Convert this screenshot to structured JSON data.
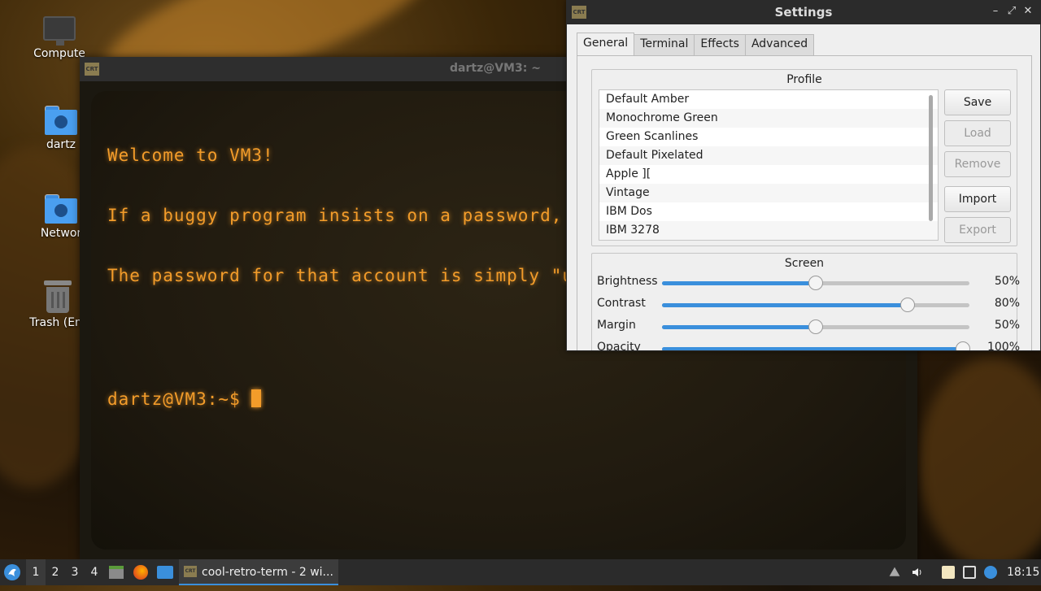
{
  "desktop": {
    "icons": [
      {
        "label": "Compute",
        "icon": "computer-icon"
      },
      {
        "label": "dartz",
        "icon": "home-folder-icon"
      },
      {
        "label": "Networ",
        "icon": "network-folder-icon"
      },
      {
        "label": "Trash (Em",
        "icon": "trash-icon"
      }
    ]
  },
  "terminal": {
    "app_icon": "CRT",
    "title": "dartz@VM3: ~",
    "lines": [
      "Welcome to VM3!",
      "If a buggy program insists on a password, us",
      "The password for that account is simply \"us"
    ],
    "prompt": "dartz@VM3:~$ ",
    "text_color": "#f39c2a"
  },
  "settings": {
    "app_icon": "CRT",
    "title": "Settings",
    "window_buttons": [
      "–",
      "⤢",
      "✕"
    ],
    "tabs": [
      "General",
      "Terminal",
      "Effects",
      "Advanced"
    ],
    "active_tab": "General",
    "profile": {
      "title": "Profile",
      "items": [
        "Default Amber",
        "Monochrome Green",
        "Green Scanlines",
        "Default Pixelated",
        "Apple ][",
        "Vintage",
        "IBM Dos",
        "IBM 3278"
      ],
      "buttons": {
        "save": "Save",
        "load": "Load",
        "remove": "Remove",
        "import": "Import",
        "export": "Export"
      }
    },
    "screen": {
      "title": "Screen",
      "sliders": [
        {
          "label": "Brightness",
          "value": 50,
          "display": "50%"
        },
        {
          "label": "Contrast",
          "value": 80,
          "display": "80%"
        },
        {
          "label": "Margin",
          "value": 50,
          "display": "50%"
        },
        {
          "label": "Opacity",
          "value": 100,
          "display": "100%"
        }
      ]
    },
    "accent": "#3a8fdc"
  },
  "taskbar": {
    "workspaces": [
      "1",
      "2",
      "3",
      "4"
    ],
    "active_workspace": "1",
    "task_label": "cool-retro-term - 2 wi...",
    "task_icon": "CRT",
    "clock": "18:15"
  }
}
